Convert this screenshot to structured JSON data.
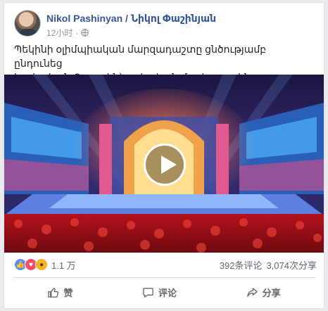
{
  "post": {
    "author": "Nikol Pashinyan / Նիկոլ Փաշինյան",
    "time": "12小时",
    "separator": "·",
    "text": "Պեկինի օլիմպիական մարզադաշտը ցնծությամբ ընդունեց\nհայկական Քոչարին՝ ասիական մշակութային փառատոնում:)"
  },
  "video": {
    "thumbnail_icon": "stage-scene-image",
    "play_icon": "play-icon"
  },
  "stats": {
    "reaction_count": "1.1 万",
    "comments": "392条评论",
    "shares": "3,074次分享",
    "reactions": [
      "like-icon",
      "love-icon",
      "wow-icon"
    ]
  },
  "actions": {
    "like_label": "赞",
    "comment_label": "评论",
    "share_label": "分享"
  },
  "colors": {
    "author": "#365899",
    "meta": "#90949c",
    "like": "#5890ff",
    "love": "#f25268",
    "wow": "#f7b125"
  }
}
